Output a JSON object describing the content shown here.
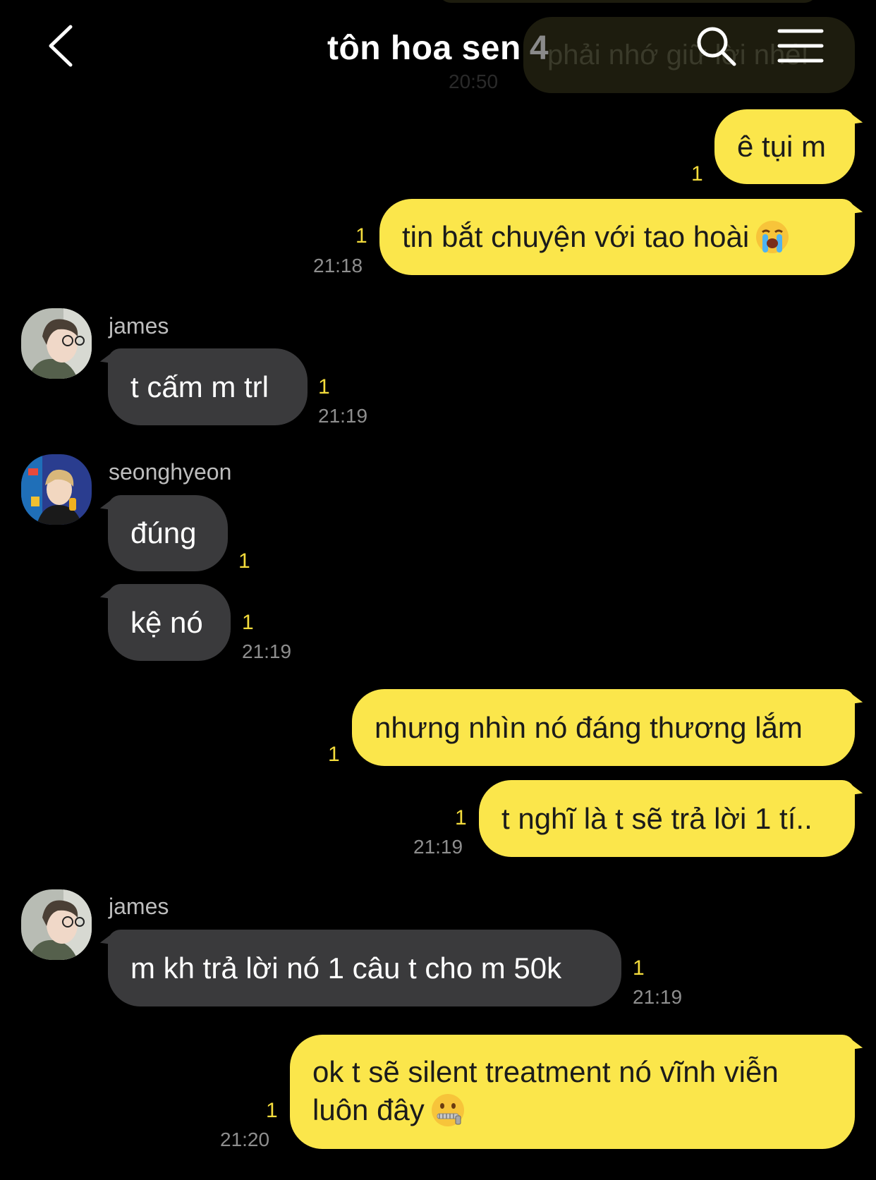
{
  "header": {
    "title": "tôn hoa sen",
    "member_count": "4"
  },
  "ghost": {
    "prev_message": "phải nhớ giữ lời nhé!",
    "prev_time": "20:50"
  },
  "messages": [
    {
      "text": "ê tụi m",
      "read": "1",
      "time": ""
    },
    {
      "text": "tin bắt chuyện với tao hoài",
      "emoji": "loudly-crying-face",
      "read": "1",
      "time": "21:18"
    },
    {
      "sender": "james",
      "text": "t cấm m trl",
      "read": "1",
      "time": "21:19"
    },
    {
      "sender": "seonghyeon",
      "text": "đúng",
      "read": "1",
      "time": ""
    },
    {
      "text": "kệ nó",
      "read": "1",
      "time": "21:19"
    },
    {
      "text": "nhưng nhìn nó đáng thương lắm",
      "read": "1",
      "time": ""
    },
    {
      "text": "t nghĩ là t sẽ trả lời 1 tí..",
      "read": "1",
      "time": "21:19"
    },
    {
      "sender": "james",
      "text": "m kh trả lời nó 1 câu t cho m 50k",
      "read": "1",
      "time": "21:19"
    },
    {
      "text_line1": "ok t sẽ silent treatment nó vĩnh viễn",
      "text_line2": "luôn đây",
      "emoji": "zipper-mouth-face",
      "read": "1",
      "time": "21:20"
    }
  ],
  "colors": {
    "background": "#000000",
    "my_bubble": "#fbe64b",
    "their_bubble": "#3a3a3c",
    "read_count": "#f4dc3c"
  }
}
